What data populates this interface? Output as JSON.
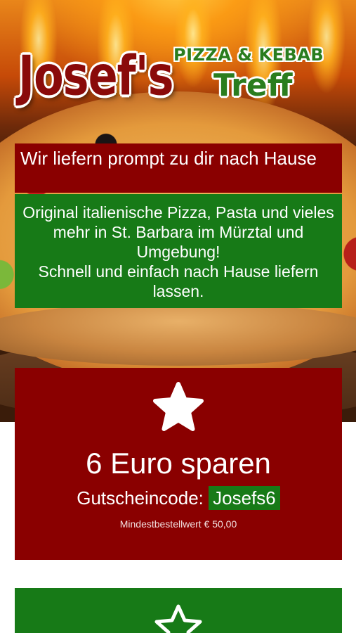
{
  "logo": {
    "name": "Josef's",
    "subtitle": "PIZZA & KEBAB",
    "treff": "Treff"
  },
  "tagline": "Wir liefern prompt zu dir nach Hause",
  "intro": {
    "line1": "Original italienische Pizza, Pasta und vieles mehr in St. Barbara im Mürztal und Umgebung!",
    "line2": "Schnell und einfach nach Hause liefern lassen."
  },
  "offer": {
    "icon": "star-icon",
    "title": "6 Euro sparen",
    "code_label": "Gutscheincode:",
    "code": "Josefs6",
    "min_order": "Mindestbestellwert € 50,00"
  },
  "next_card": {
    "icon": "star-icon"
  },
  "colors": {
    "red": "#8a0000",
    "green": "#177a17"
  }
}
